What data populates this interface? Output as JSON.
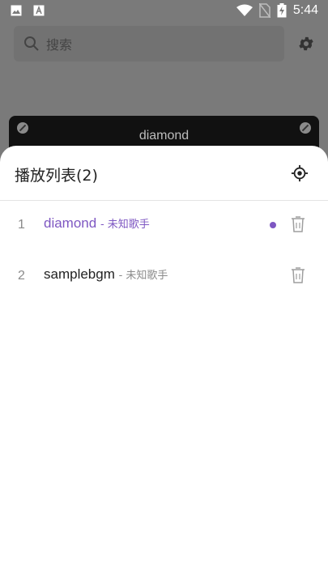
{
  "status_bar": {
    "time": "5:44",
    "left_icons": [
      "image-icon",
      "text-a-icon"
    ],
    "right_icons": [
      "wifi-icon",
      "no-sim-icon",
      "battery-icon"
    ]
  },
  "search": {
    "placeholder": "搜索"
  },
  "player": {
    "current_title": "diamond"
  },
  "playlist": {
    "title": "播放列表(2)",
    "items": [
      {
        "index": "1",
        "name": "diamond",
        "artist": "- 未知歌手",
        "active": true
      },
      {
        "index": "2",
        "name": "samplebgm",
        "artist": "- 未知歌手",
        "active": false
      }
    ]
  },
  "colors": {
    "accent": "#7e57c2",
    "overlay": "#7a7a7a",
    "text_primary": "#222222",
    "text_secondary": "#8a8a8a"
  }
}
